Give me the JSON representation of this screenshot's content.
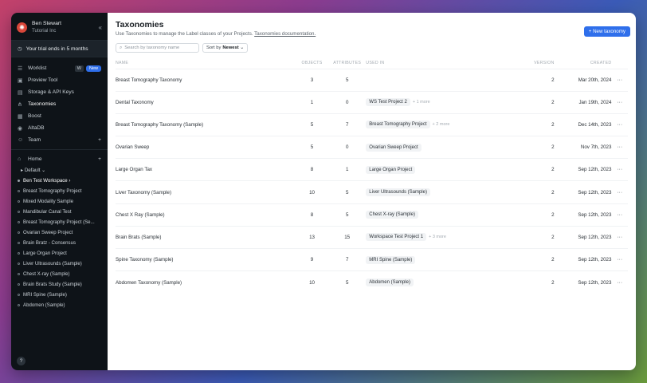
{
  "sidebar": {
    "user": "Ben Stewart",
    "org": "Tutorial Inc",
    "trial": "Your trial ends in 5 months",
    "nav": [
      {
        "label": "Worklist",
        "kbd": "W",
        "badge": "New"
      },
      {
        "label": "Preview Tool"
      },
      {
        "label": "Storage & API Keys"
      },
      {
        "label": "Taxonomies"
      },
      {
        "label": "Boost"
      },
      {
        "label": "AltaDB"
      },
      {
        "label": "Team"
      }
    ],
    "home": "Home",
    "default": "Default",
    "workspaces": [
      "Ben Test Workspace",
      "Breast Tomography Project",
      "Mixed Modality Sample",
      "Mandibular Canal Test",
      "Breast Tomography Project (Se...",
      "Ovarian Sweep Project",
      "Brain Bratz - Consensus",
      "Large Organ Project",
      "Liver Ultrasounds (Sample)",
      "Chest X-ray (Sample)",
      "Brain Brats Study (Sample)",
      "MRI Spine (Sample)",
      "Abdomen (Sample)"
    ]
  },
  "main": {
    "title": "Taxonomies",
    "subtitle": "Use Taxonomies to manage the Label classes of your Projects.",
    "doc_link": "Taxonomies documentation.",
    "new_button": "+ New taxonomy",
    "search_placeholder": "Search by taxonomy name",
    "sort_label": "Sort by",
    "sort_value": "Newest",
    "columns": [
      "NAME",
      "OBJECTS",
      "ATTRIBUTES",
      "USED IN",
      "VERSION",
      "CREATED"
    ],
    "rows": [
      {
        "name": "Breast Tomography Taxonomy",
        "objects": "3",
        "attributes": "5",
        "used_in": "",
        "more": "",
        "version": "2",
        "created": "Mar 20th, 2024"
      },
      {
        "name": "Dental Taxonomy",
        "objects": "1",
        "attributes": "0",
        "used_in": "WS Test Project 2",
        "more": "+ 1 more",
        "version": "2",
        "created": "Jan 19th, 2024"
      },
      {
        "name": "Breast Tomography Taxonomy (Sample)",
        "objects": "5",
        "attributes": "7",
        "used_in": "Breast Tomography Project",
        "more": "+ 2 more",
        "version": "2",
        "created": "Dec 14th, 2023"
      },
      {
        "name": "Ovarian Sweep",
        "objects": "5",
        "attributes": "0",
        "used_in": "Ovarian Sweep Project",
        "more": "",
        "version": "2",
        "created": "Nov 7th, 2023"
      },
      {
        "name": "Large Organ Tax",
        "objects": "8",
        "attributes": "1",
        "used_in": "Large Organ Project",
        "more": "",
        "version": "2",
        "created": "Sep 12th, 2023"
      },
      {
        "name": "Liver Taxonomy (Sample)",
        "objects": "10",
        "attributes": "5",
        "used_in": "Liver Ultrasounds (Sample)",
        "more": "",
        "version": "2",
        "created": "Sep 12th, 2023"
      },
      {
        "name": "Chest X Ray (Sample)",
        "objects": "8",
        "attributes": "5",
        "used_in": "Chest X-ray (Sample)",
        "more": "",
        "version": "2",
        "created": "Sep 12th, 2023"
      },
      {
        "name": "Brain Brats (Sample)",
        "objects": "13",
        "attributes": "15",
        "used_in": "Workspace Test Project 1",
        "more": "+ 3 more",
        "version": "2",
        "created": "Sep 12th, 2023"
      },
      {
        "name": "Spine Taxonomy (Sample)",
        "objects": "9",
        "attributes": "7",
        "used_in": "MRI Spine (Sample)",
        "more": "",
        "version": "2",
        "created": "Sep 12th, 2023"
      },
      {
        "name": "Abdomen Taxonomy (Sample)",
        "objects": "10",
        "attributes": "5",
        "used_in": "Abdomen (Sample)",
        "more": "",
        "version": "2",
        "created": "Sep 12th, 2023"
      }
    ]
  }
}
